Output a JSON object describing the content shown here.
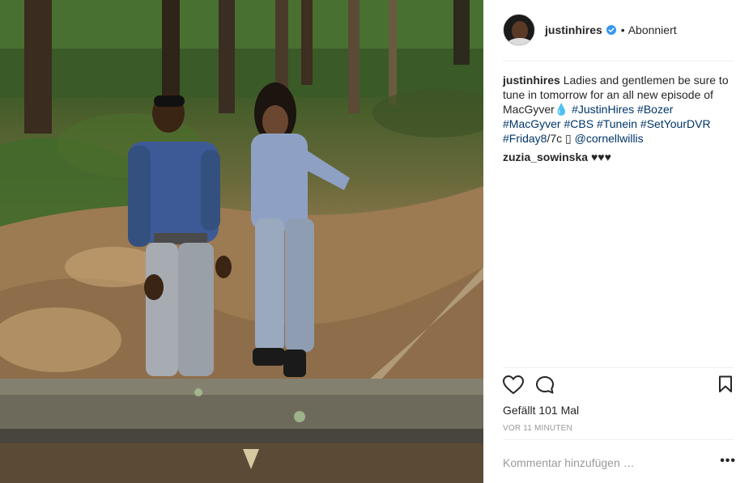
{
  "post": {
    "image_alt": "Two people standing in a forest clearing looking at a fallen tree trunk",
    "author": {
      "username": "justinhires",
      "verified": true,
      "separator": "•",
      "follow_state": "Abonniert"
    },
    "caption": {
      "username": "justinhires",
      "text_before": "Ladies and gentlemen be sure to tune in tomorrow for an all new episode of MacGyver💧",
      "hashtags": [
        "#JustinHires",
        "#Bozer",
        "#MacGyver",
        "#CBS",
        "#Tunein",
        "#SetYourDVR",
        "#Friday8"
      ],
      "text_after": "/7c ",
      "box_glyph": "▯",
      "mention": "@cornellwillis"
    },
    "comments": [
      {
        "username": "zuzia_sowinska",
        "text": "♥♥♥"
      }
    ],
    "actions": {
      "like_icon": "heart-outline-icon",
      "comment_icon": "speech-bubble-icon",
      "save_icon": "bookmark-icon"
    },
    "likes_text": "Gefällt 101 Mal",
    "timestamp": "VOR 11 MINUTEN",
    "add_comment": {
      "placeholder": "Kommentar hinzufügen …",
      "more_label": "•••"
    },
    "colors": {
      "link": "#003569",
      "verified": "#3897f0",
      "muted": "#999999",
      "divider": "#efefef"
    }
  }
}
